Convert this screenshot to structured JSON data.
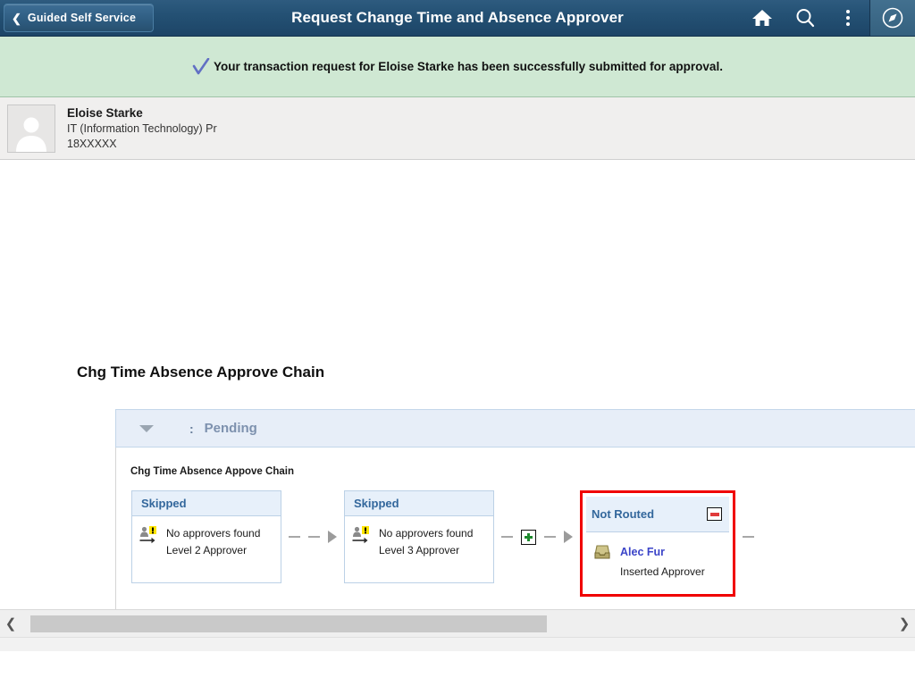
{
  "header": {
    "back_label": "Guided Self Service",
    "back_icon": "chevron-left-icon",
    "title": "Request Change Time and Absence Approver",
    "icons": [
      {
        "name": "home-icon",
        "label": "Home"
      },
      {
        "name": "search-icon",
        "label": "Search"
      },
      {
        "name": "actions-menu-icon",
        "label": "Actions"
      },
      {
        "name": "nav-bar-icon",
        "label": "NavBar"
      }
    ],
    "bg_color": "#245174"
  },
  "message": {
    "icon": "checkmark-icon",
    "text": "Your transaction request for Eloise Starke has been successfully submitted for approval.",
    "bg_color": "#cfe8d3"
  },
  "employee": {
    "avatar_icon": "person-avatar-icon",
    "name": "Eloise Starke",
    "department": "IT (Information Technology) Pr",
    "emplid": "18XXXXX"
  },
  "main": {
    "page_title": "Chg Time Absence Approve Chain",
    "stage": {
      "caret_icon": "chevron-down-icon",
      "separator": ":",
      "status": "Pending"
    },
    "chain_label": "Chg Time Absence Appove Chain",
    "nodes": [
      {
        "status": "Skipped",
        "icon": "approver-skipped-icon",
        "line1": "No approvers found",
        "line2": "Level 2 Approver",
        "highlighted": false
      },
      {
        "status": "Skipped",
        "icon": "approver-skipped-icon",
        "line1": "No approvers found",
        "line2": "Level 3 Approver",
        "highlighted": false
      },
      {
        "status": "Not Routed",
        "icon": "inbox-tray-icon",
        "approver_name": "Alec Fur",
        "line2": "Inserted Approver",
        "remove_icon": "minus-icon",
        "highlighted": true,
        "highlight_color": "#f00000"
      }
    ],
    "connectors": [
      {
        "has_insert_button": false,
        "insert_icon": "plus-icon"
      },
      {
        "has_insert_button": true,
        "insert_icon": "plus-icon"
      }
    ],
    "trailing_connector": {
      "dash": true
    }
  },
  "footer": {
    "scroll_left_icon": "chevron-left-icon",
    "scroll_right_icon": "chevron-right-icon"
  }
}
